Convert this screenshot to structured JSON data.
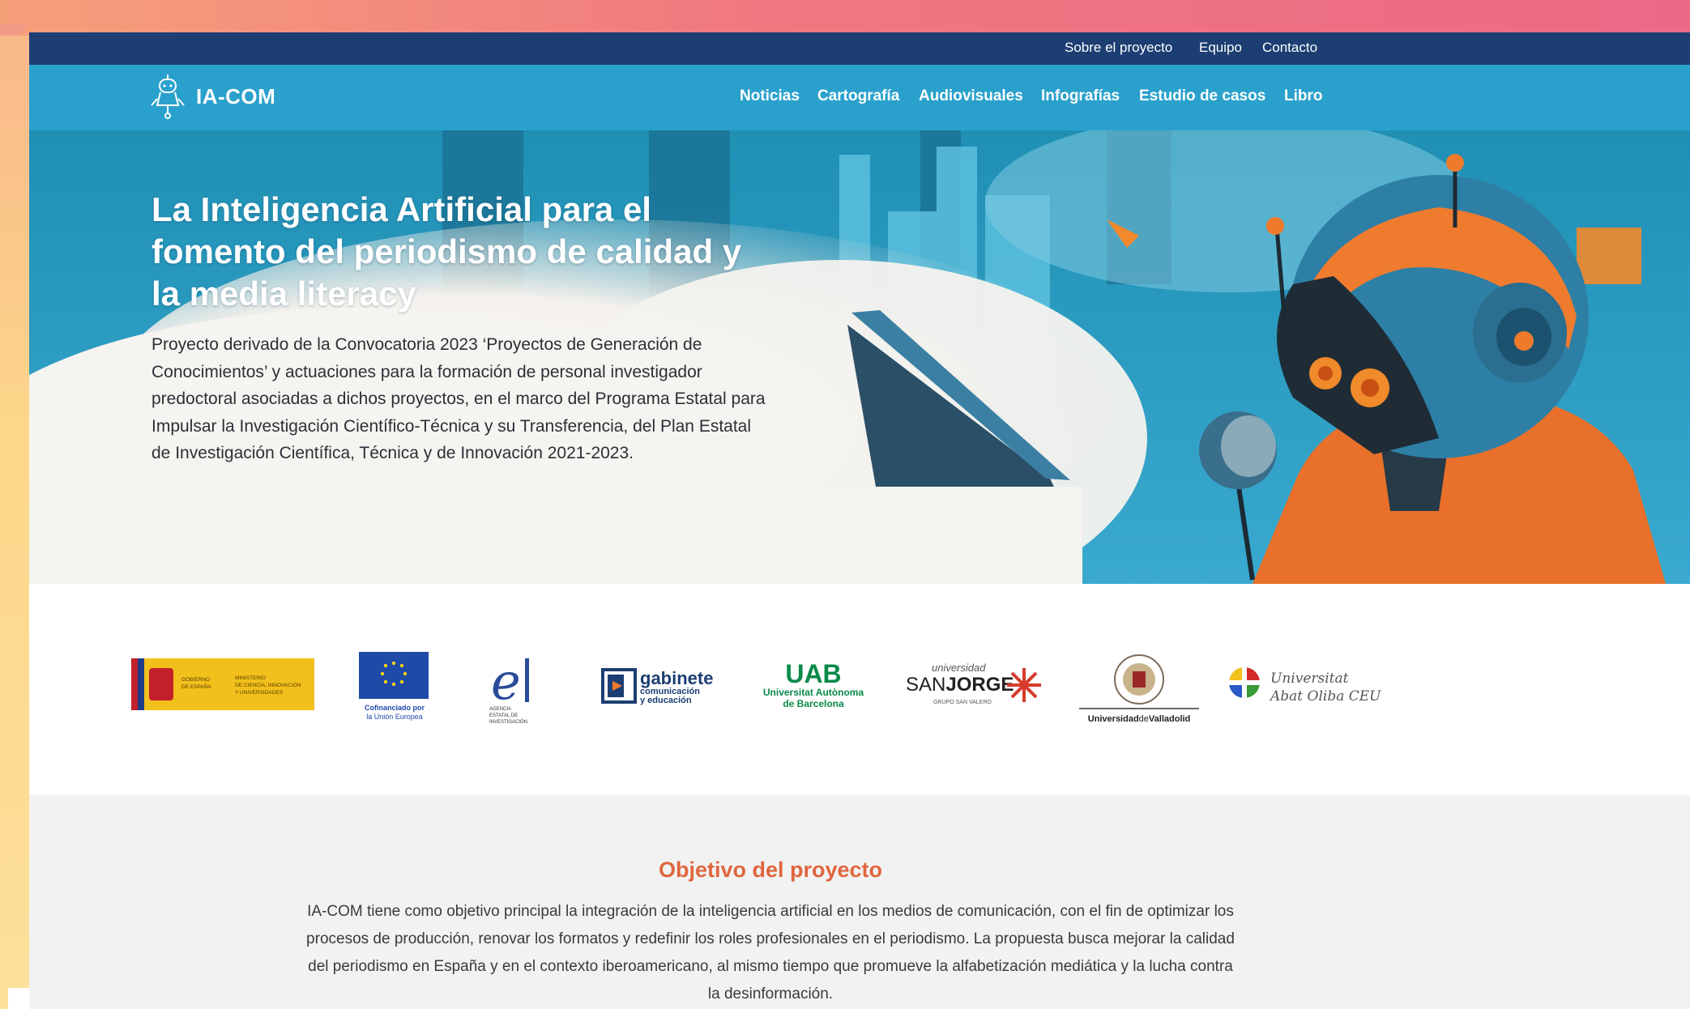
{
  "topbar": {
    "links": [
      "Sobre el proyecto",
      "Equipo",
      "Contacto"
    ]
  },
  "header": {
    "logo_text": "IA-COM",
    "nav": [
      "Noticias",
      "Cartografía",
      "Audiovisuales",
      "Infografías",
      "Estudio de casos",
      "Libro"
    ]
  },
  "hero": {
    "title": "La Inteligencia Artificial para el fomento del periodismo de calidad y la media literacy",
    "description": "Proyecto derivado de la Convocatoria 2023 ‘Proyectos de Generación de Conocimientos’ y actuaciones para la formación de personal investigador predoctoral asociadas a dichos proyectos, en el marco del Programa Estatal para Impulsar la Investigación Científico-Técnica y su Transferencia, del Plan Estatal de Investigación Científica, Técnica y de Innovación 2021-2023."
  },
  "partners": {
    "gobierno": {
      "line1": "GOBIERNO",
      "line2": "DE ESPAÑA",
      "ministry1": "MINISTERIO",
      "ministry2": "DE CIENCIA, INNOVACIÓN",
      "ministry3": "Y UNIVERSIDADES"
    },
    "eu": {
      "line1": "Cofinanciado por",
      "line2": "la Unión Europea"
    },
    "aei": {
      "line1": "AGENCIA",
      "line2": "ESTATAL DE",
      "line3": "INVESTIGACIÓN"
    },
    "gabinete": {
      "line1": "gabinete",
      "line2": "comunicación",
      "line3": "y educación"
    },
    "uab": {
      "line1": "UAB",
      "line2": "Universitat Autònoma",
      "line3": "de Barcelona"
    },
    "sanjorge": {
      "line1": "universidad",
      "line2a": "SAN",
      "line2b": "JORGE",
      "line3": "GRUPO SAN VALERO"
    },
    "valladolid": {
      "line1a": "Universidad",
      "line1b": "de",
      "line1c": "Valladolid"
    },
    "abatoliba": {
      "line1": "Universitat",
      "line2": "Abat Oliba CEU"
    }
  },
  "objective": {
    "title": "Objetivo del proyecto",
    "text": "IA-COM tiene como objetivo principal la integración de la inteligencia artificial en los medios de comunicación, con el fin de optimizar los procesos de producción, renovar los formatos y redefinir los roles profesionales en el periodismo. La propuesta busca mejorar la calidad del periodismo en España y en el contexto iberoamericano, al mismo tiempo que promueve la alfabetización mediática y la lucha contra la desinformación."
  },
  "colors": {
    "topbar": "#1c3e72",
    "navbar": "#2aa1cc",
    "accent": "#e0663e"
  }
}
